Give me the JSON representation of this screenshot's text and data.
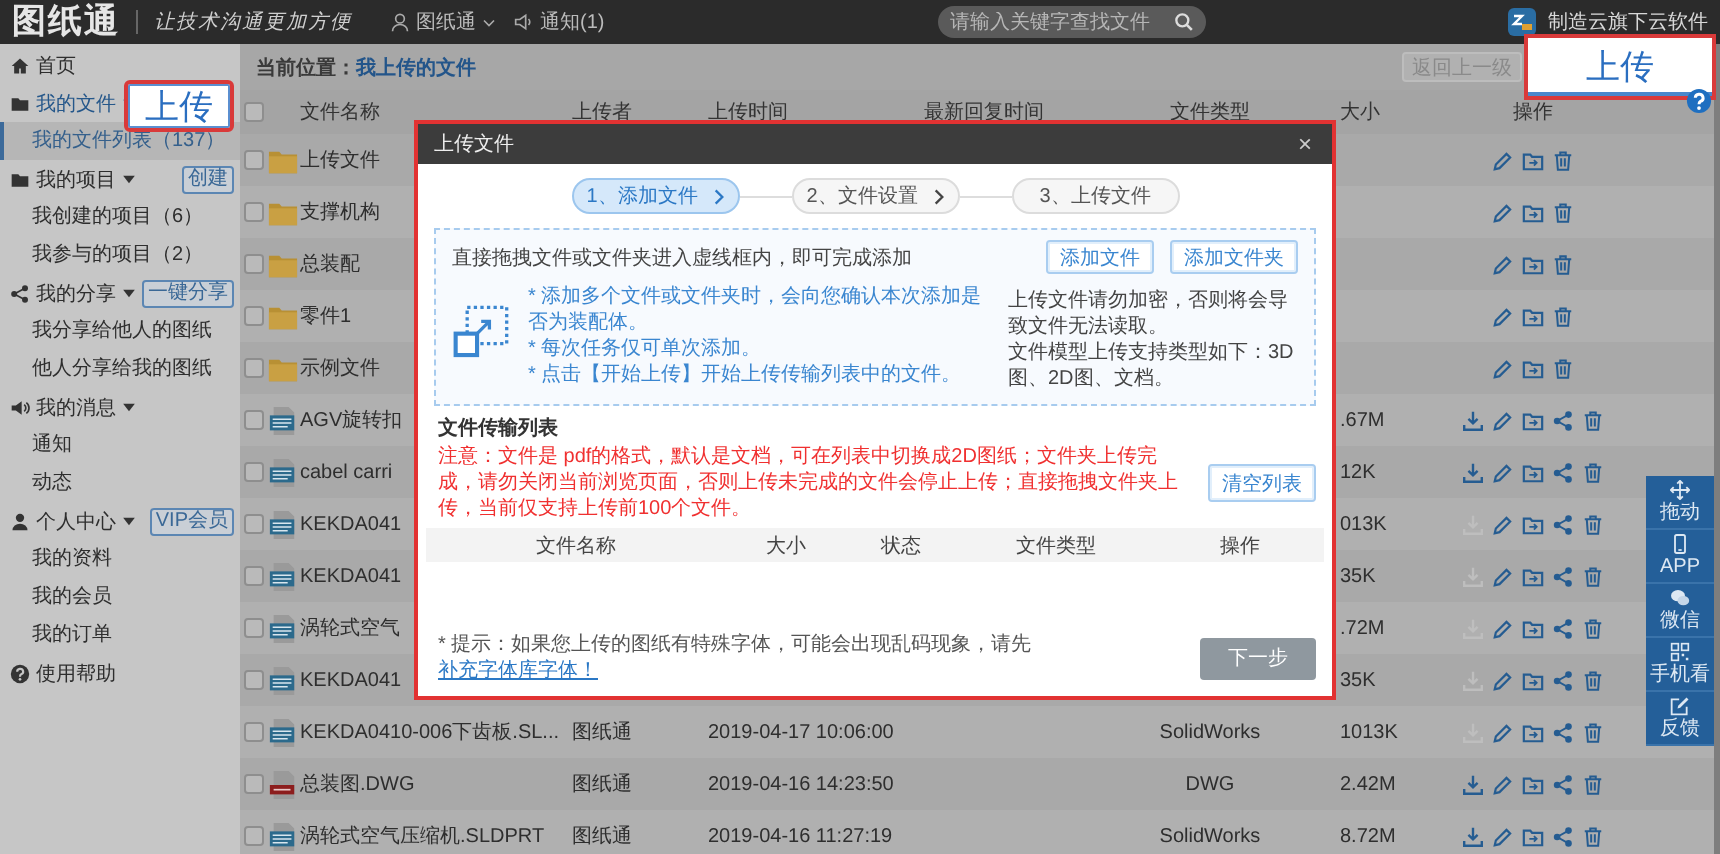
{
  "top_bar": {
    "logo": "图纸通",
    "slogan": "让技术沟通更加方便",
    "user": "图纸通",
    "notifications": "通知(1)",
    "search": {
      "placeholder": "请输入关键字查找文件"
    },
    "brand": "制造云旗下云软件"
  },
  "sidebar": {
    "items": [
      {
        "label": "首页",
        "kind": "home",
        "selected": false
      },
      {
        "label": "我的文件",
        "kind": "folder",
        "selected": true,
        "expanded": true,
        "children": [
          {
            "label": "我的文件列表（137）",
            "selected": true
          }
        ]
      },
      {
        "label": "我的项目",
        "kind": "folder",
        "selected": false,
        "expanded": true,
        "button": "创建",
        "children": [
          {
            "label": "我创建的项目（6）",
            "selected": false
          },
          {
            "label": "我参与的项目（2）",
            "selected": false
          }
        ]
      },
      {
        "label": "我的分享",
        "kind": "share",
        "selected": false,
        "expanded": true,
        "button": "一键分享",
        "children": [
          {
            "label": "我分享给他人的图纸",
            "selected": false
          },
          {
            "label": "他人分享给我的图纸",
            "selected": false
          }
        ]
      },
      {
        "label": "我的消息",
        "kind": "speaker",
        "selected": false,
        "expanded": true,
        "children": [
          {
            "label": "通知",
            "selected": false
          },
          {
            "label": "动态",
            "selected": false
          }
        ]
      },
      {
        "label": "个人中心",
        "kind": "user",
        "selected": false,
        "expanded": true,
        "button": "VIP会员",
        "children": [
          {
            "label": "我的资料",
            "selected": false
          },
          {
            "label": "我的会员",
            "selected": false
          },
          {
            "label": "我的订单",
            "selected": false
          }
        ]
      },
      {
        "label": "使用帮助",
        "kind": "help",
        "selected": false
      }
    ]
  },
  "breadcrumb": {
    "label": "当前位置：",
    "link": "我上传的文件"
  },
  "back_button": {
    "label": "返回上一级",
    "disabled": true
  },
  "table": {
    "header_checked": false,
    "columns": [
      "文件名称",
      "上传者",
      "上传时间",
      "最新回复时间",
      "文件类型",
      "大小",
      "操作"
    ],
    "rows": [
      {
        "kind": "folder",
        "checked": false,
        "name": "上传文件"
      },
      {
        "kind": "folder",
        "checked": false,
        "name": "支撑机构"
      },
      {
        "kind": "folder",
        "checked": false,
        "name": "总装配"
      },
      {
        "kind": "folder",
        "checked": false,
        "name": "零件1"
      },
      {
        "kind": "folder",
        "checked": false,
        "name": "示例文件"
      },
      {
        "kind": "solidworks",
        "checked": false,
        "name": "AGV旋转扣",
        "size": ".67M",
        "download_disabled": false
      },
      {
        "kind": "solidworks",
        "checked": false,
        "name": "cabel carri",
        "size": "12K",
        "download_disabled": false
      },
      {
        "kind": "solidworks",
        "checked": false,
        "name": "KEKDA041",
        "size": "013K",
        "download_disabled": true
      },
      {
        "kind": "solidworks",
        "checked": false,
        "name": "KEKDA041",
        "size": "35K",
        "download_disabled": true
      },
      {
        "kind": "solidworks",
        "checked": false,
        "name": "涡轮式空气",
        "size": ".72M",
        "download_disabled": true
      },
      {
        "kind": "solidworks",
        "checked": false,
        "name": "KEKDA041",
        "size": "35K",
        "download_disabled": true
      },
      {
        "kind": "solidworks",
        "checked": false,
        "name": "KEKDA0410-006下齿板.SL...",
        "uploader": "图纸通",
        "uploaded": "2019-04-17 10:06:00",
        "type": "SolidWorks",
        "size": "1013K",
        "download_disabled": true
      },
      {
        "kind": "dwg",
        "checked": false,
        "name": "总装图.DWG",
        "uploader": "图纸通",
        "uploaded": "2019-04-16 14:23:50",
        "type": "DWG",
        "size": "2.42M",
        "download_disabled": false
      },
      {
        "kind": "solidworks",
        "checked": false,
        "name": "涡轮式空气压缩机.SLDPRT",
        "uploader": "图纸通",
        "uploaded": "2019-04-16 11:27:19",
        "type": "SolidWorks",
        "size": "8.72M",
        "download_disabled": false
      }
    ]
  },
  "modal": {
    "title": "上传文件",
    "close": "×",
    "steps": [
      {
        "label": "1、添加文件",
        "selected": true
      },
      {
        "label": "2、文件设置",
        "selected": false
      },
      {
        "label": "3、上传文件",
        "selected": false
      }
    ],
    "drop_hint": "直接拖拽文件或文件夹进入虚线框内，即可完成添加",
    "buttons": [
      "添加文件",
      "添加文件夹"
    ],
    "tips": [
      "* 添加多个文件或文件夹时，会向您确认本次添加是否为装配体。",
      "* 每次任务仅可单次添加。",
      "* 点击【开始上传】开始上传传输列表中的文件。"
    ],
    "notes": [
      "上传文件请勿加密，否则将会导致文件无法读取。",
      "文件模型上传支持类型如下：3D图、2D图、文档。"
    ],
    "list_title": "文件传输列表",
    "warning": "注意：文件是 pdf的格式，默认是文档，可在列表中切换成2D图纸；文件夹上传完成，请勿关闭当前浏览页面，否则上传未完成的文件会停止上传；直接拖拽文件夹上传，当前仅支持上传前100个文件。",
    "clear_button": "清空列表",
    "list_columns": [
      "文件名称",
      "大小",
      "状态",
      "文件类型",
      "操作"
    ],
    "footer_hint": "* 提示：如果您上传的图纸有特殊字体，可能会出现乱码现象，请先",
    "footer_link": "补充字体库字体！",
    "next_button": {
      "label": "下一步",
      "disabled": true
    }
  },
  "callouts": [
    {
      "label": "上传"
    },
    {
      "label": "上传"
    }
  ],
  "float_toolbar": [
    {
      "label": "拖动",
      "kind": "move"
    },
    {
      "label": "APP",
      "kind": "phone"
    },
    {
      "label": "微信",
      "kind": "chat"
    },
    {
      "label": "手机看",
      "kind": "qr"
    },
    {
      "label": "反馈",
      "kind": "edit"
    }
  ]
}
